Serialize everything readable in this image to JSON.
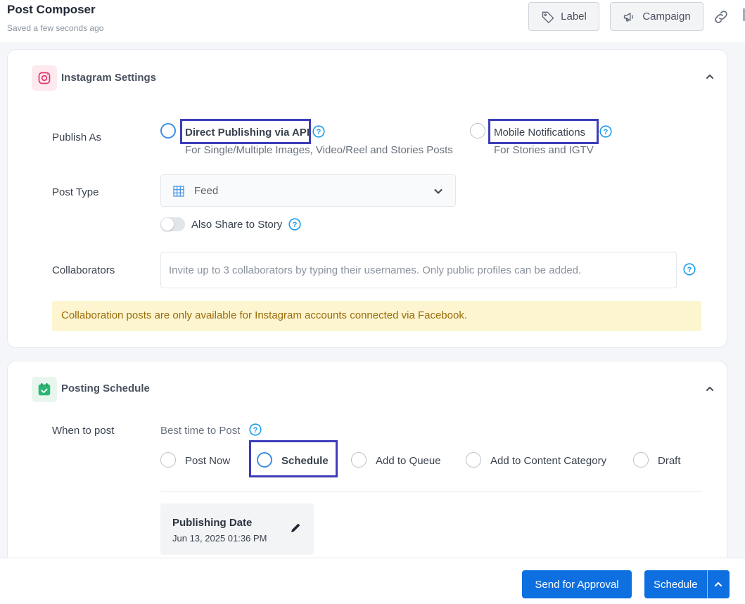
{
  "header": {
    "title": "Post Composer",
    "subtitle": "Saved a few seconds ago",
    "label_button": "Label",
    "campaign_button": "Campaign"
  },
  "instagram": {
    "section_title": "Instagram Settings",
    "publish_as_label": "Publish As",
    "direct_publishing": {
      "title": "Direct Publishing via API",
      "subtitle": "For Single/Multiple Images, Video/Reel and Stories Posts",
      "selected": true
    },
    "mobile_notifications": {
      "title": "Mobile Notifications",
      "subtitle": "For Stories and IGTV",
      "selected": false
    },
    "post_type_label": "Post Type",
    "post_type_value": "Feed",
    "share_story_label": "Also Share to Story",
    "share_story_on": false,
    "collaborators_label": "Collaborators",
    "collaborators_placeholder": "Invite up to 3 collaborators by typing their usernames. Only public profiles can be added.",
    "notice": "Collaboration posts are only available for Instagram accounts connected via Facebook."
  },
  "schedule": {
    "section_title": "Posting Schedule",
    "when_label": "When to post",
    "best_time_label": "Best time to Post",
    "options": [
      {
        "label": "Post Now",
        "selected": false
      },
      {
        "label": "Schedule",
        "selected": true
      },
      {
        "label": "Add to Queue",
        "selected": false
      },
      {
        "label": "Add to Content Category",
        "selected": false
      },
      {
        "label": "Draft",
        "selected": false
      }
    ],
    "publishing_date_title": "Publishing Date",
    "publishing_date_value": "Jun 13, 2025 01:36 PM"
  },
  "footer": {
    "send_approval": "Send for Approval",
    "schedule": "Schedule"
  },
  "colors": {
    "primary": "#0d6fe0",
    "radio_selected": "#3b8fe4",
    "highlight": "#3d3dbb",
    "notice_bg": "#fdf5cf",
    "notice_text": "#9a6b0a",
    "help_icon": "#1a9be8",
    "instagram": "#e1306c",
    "calendar": "#2bb673"
  }
}
